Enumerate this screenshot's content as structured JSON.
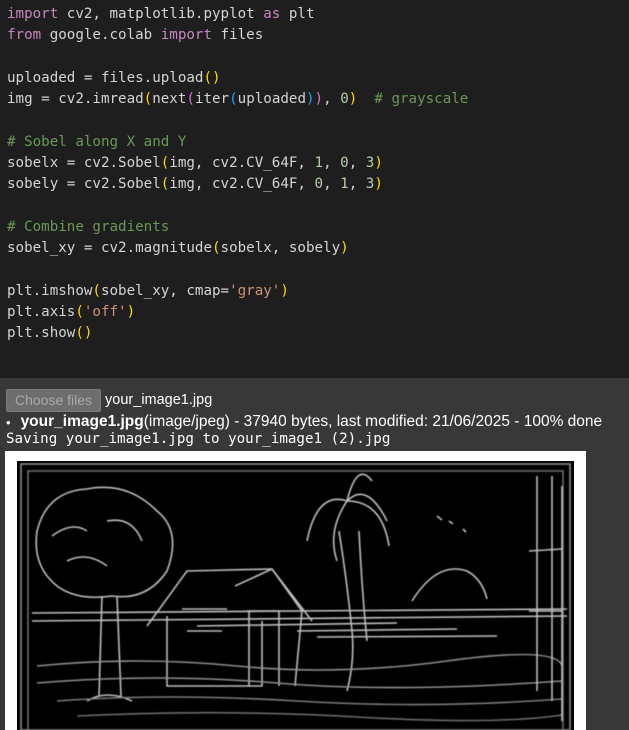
{
  "code": {
    "lines": [
      [
        {
          "t": "import",
          "c": "kw"
        },
        {
          "t": " cv2, matplotlib.pyplot "
        },
        {
          "t": "as",
          "c": "kw"
        },
        {
          "t": " plt"
        }
      ],
      [
        {
          "t": "from",
          "c": "kw"
        },
        {
          "t": " google.colab "
        },
        {
          "t": "import",
          "c": "kw"
        },
        {
          "t": " files"
        }
      ],
      [],
      [
        {
          "t": "uploaded = files.upload"
        },
        {
          "t": "()",
          "c": "p1"
        }
      ],
      [
        {
          "t": "img = cv2.imread"
        },
        {
          "t": "(",
          "c": "p1"
        },
        {
          "t": "next"
        },
        {
          "t": "(",
          "c": "p2"
        },
        {
          "t": "iter"
        },
        {
          "t": "(",
          "c": "p3"
        },
        {
          "t": "uploaded"
        },
        {
          "t": ")",
          "c": "p3"
        },
        {
          "t": ")",
          "c": "p2"
        },
        {
          "t": ", "
        },
        {
          "t": "0",
          "c": "num"
        },
        {
          "t": ")",
          "c": "p1"
        },
        {
          "t": "  "
        },
        {
          "t": "# grayscale",
          "c": "cm"
        }
      ],
      [],
      [
        {
          "t": "# Sobel along X and Y",
          "c": "cm"
        }
      ],
      [
        {
          "t": "sobelx = cv2.Sobel"
        },
        {
          "t": "(",
          "c": "p1"
        },
        {
          "t": "img, cv2.CV_64F, "
        },
        {
          "t": "1",
          "c": "num"
        },
        {
          "t": ", "
        },
        {
          "t": "0",
          "c": "num"
        },
        {
          "t": ", "
        },
        {
          "t": "3",
          "c": "num"
        },
        {
          "t": ")",
          "c": "p1"
        }
      ],
      [
        {
          "t": "sobely = cv2.Sobel"
        },
        {
          "t": "(",
          "c": "p1"
        },
        {
          "t": "img, cv2.CV_64F, "
        },
        {
          "t": "0",
          "c": "num"
        },
        {
          "t": ", "
        },
        {
          "t": "1",
          "c": "num"
        },
        {
          "t": ", "
        },
        {
          "t": "3",
          "c": "num"
        },
        {
          "t": ")",
          "c": "p1"
        }
      ],
      [],
      [
        {
          "t": "# Combine gradients",
          "c": "cm"
        }
      ],
      [
        {
          "t": "sobel_xy = cv2.magnitude"
        },
        {
          "t": "(",
          "c": "p1"
        },
        {
          "t": "sobelx, sobely"
        },
        {
          "t": ")",
          "c": "p1"
        }
      ],
      [],
      [
        {
          "t": "plt.imshow"
        },
        {
          "t": "(",
          "c": "p1"
        },
        {
          "t": "sobel_xy, cmap="
        },
        {
          "t": "'gray'",
          "c": "str"
        },
        {
          "t": ")",
          "c": "p1"
        }
      ],
      [
        {
          "t": "plt.axis"
        },
        {
          "t": "(",
          "c": "p1"
        },
        {
          "t": "'off'",
          "c": "str"
        },
        {
          "t": ")",
          "c": "p1"
        }
      ],
      [
        {
          "t": "plt.show"
        },
        {
          "t": "()",
          "c": "p1"
        }
      ]
    ]
  },
  "output": {
    "choose_button": "Choose files",
    "chosen_file": "your_image1.jpg",
    "upload_item": {
      "bullet": "•",
      "filename": "your_image1.jpg",
      "details": "(image/jpeg) - 37940 bytes, last modified: 21/06/2025 - 100% done"
    },
    "saving_text": "Saving your_image1.jpg to your_image1 (2).jpg",
    "image_description_icon": "sobel-edge-image"
  },
  "colors": {
    "code_bg": "#1e1e1e",
    "output_bg": "#383838",
    "keyword": "#c586c0",
    "comment": "#6a9955",
    "number": "#b5cea8",
    "string": "#ce9178"
  }
}
